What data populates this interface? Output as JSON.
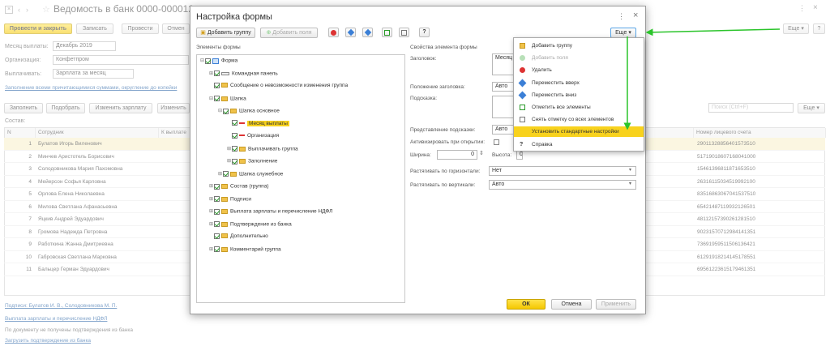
{
  "doc": {
    "title": "Ведомость в банк 0000-000012 от ...",
    "toolbar": {
      "post_close": "Провести и закрыть",
      "save": "Записать",
      "post": "Провести",
      "cancel": "Отмен",
      "more": "Еще"
    },
    "fields": {
      "month_label": "Месяц выплаты:",
      "month_value": "Декабрь 2019",
      "org_label": "Организация:",
      "org_value": "Конфетпром",
      "pay_label": "Выплачивать:",
      "pay_value": "Зарплата за месяц"
    },
    "fill_link": "Заполнение всеми причитающимися суммами, округление до копейки",
    "list_toolbar": {
      "fill": "Заполнить",
      "select": "Подобрать",
      "change": "Изменить зарплату",
      "change2": "Изменить",
      "search_placeholder": "Поиск (Ctrl+F)",
      "more": "Еще"
    },
    "table_caption": "Состав:",
    "columns": {
      "n": "N",
      "employee": "Сотрудник",
      "to_pay": "К выплате",
      "account": "Номер лицевого счета"
    },
    "rows": [
      {
        "n": "1",
        "name": "Булатов Игорь Виленович",
        "account": "29011328856401573510"
      },
      {
        "n": "2",
        "name": "Минчев Аристотель Борисович",
        "account": "51719018607168041000"
      },
      {
        "n": "3",
        "name": "Солодовникова Мария Пахомовна",
        "account": "15461396811871653510"
      },
      {
        "n": "4",
        "name": "Мейерсон Софья Карловна",
        "account": "26316115034519992100"
      },
      {
        "n": "5",
        "name": "Орлова Елена Николаевна",
        "account": "83516863067041537510"
      },
      {
        "n": "6",
        "name": "Милова Светлана Афанасьевна",
        "account": "65421487119932126501"
      },
      {
        "n": "7",
        "name": "Яцкив Андрей Эдуардович",
        "account": "48112157390261281510"
      },
      {
        "n": "8",
        "name": "Громова Надежда Петровна",
        "account": "90231570712984141351"
      },
      {
        "n": "9",
        "name": "Работкина Жанна Дмитриевна",
        "account": "73691959511506136421"
      },
      {
        "n": "10",
        "name": "Габровская Светлана Марковна",
        "account": "61291918214145178551"
      },
      {
        "n": "11",
        "name": "Бальцер Герман Эдуардович",
        "account": "69561223615179461351"
      }
    ],
    "bottom": {
      "signatures": "Подписи: Булатов И. В., Солодовникова М. П.",
      "payout": "Выплата зарплаты и перечисление НДФЛ",
      "no_confirm": "По документу не получены подтверждения из банка",
      "load_confirm": "Загрузить подтверждение из банка"
    }
  },
  "dialog": {
    "title": "Настройка формы",
    "add_group": "Добавить группу",
    "add_fields": "Добавить поля",
    "help": "?",
    "more": "Еще",
    "tree_caption": "Элементы формы",
    "props_caption": "Свойства элемента формы",
    "tree": [
      "Форма",
      "Командная панель",
      "Сообщение о невозможности изменения группа",
      "Шапка",
      "Шапка основное",
      "Месяц выплаты",
      "Организация",
      "Выплачивать группа",
      "Заполнение",
      "Шапка служебное",
      "Состав (группа)",
      "Подписи",
      "Выплата зарплаты и перечисление НДФЛ",
      "Подтверждение из банка",
      "Дополнительно",
      "Комментарий группа"
    ],
    "props": {
      "title_label": "Заголовок:",
      "title_value": "Месяц",
      "title_pos_label": "Положение заголовка:",
      "title_pos_value": "Авто",
      "hint_label": "Подсказка:",
      "hint_view_label": "Представление подсказки:",
      "hint_view_value": "Авто",
      "activate_label": "Активизировать при открытии:",
      "width_label": "Ширина:",
      "width_value": "0",
      "height_label": "Высота:",
      "height_value": "0",
      "stretch_h_label": "Растягивать по горизонтали:",
      "stretch_h_value": "Нет",
      "stretch_v_label": "Растягивать по вертикали:",
      "stretch_v_value": "Авто"
    },
    "ok": "ОК",
    "cancel": "Отмена",
    "apply": "Применить"
  },
  "menu": {
    "items": [
      "Добавить группу",
      "Добавить поля",
      "Удалить",
      "Переместить вверх",
      "Переместить вниз",
      "Отметить все элементы",
      "Снять отметку со всех элементов",
      "Установить стандартные настройки",
      "Справка"
    ],
    "highlighted_index": 7
  },
  "colors": {
    "accent_yellow": "#f5c800",
    "highlight": "#f8d21d",
    "arrow_green": "#2bc42b",
    "link": "#1d5aa0"
  }
}
